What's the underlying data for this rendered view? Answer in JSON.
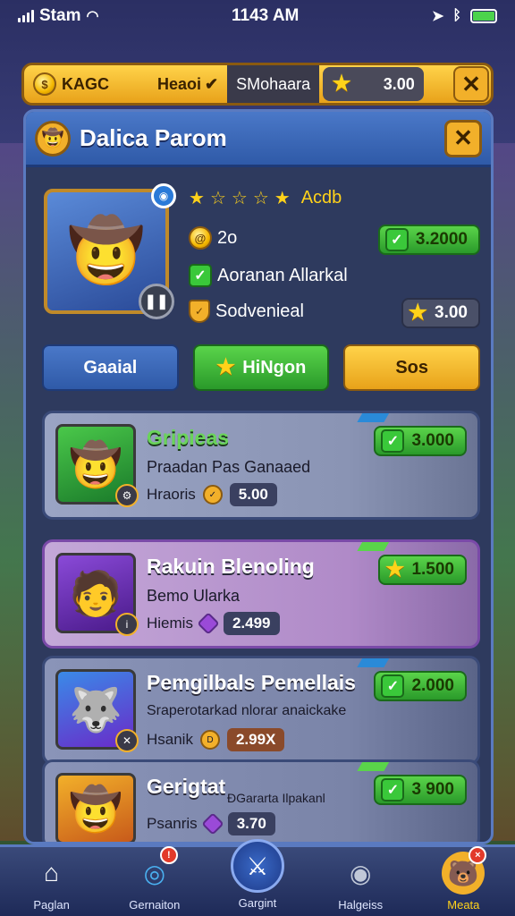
{
  "status": {
    "carrier": "Stam",
    "time": "1143 AM"
  },
  "topbar": {
    "seg1": "KAGC",
    "seg2": "Heaoi",
    "seg3": "SMohaara",
    "currency_value": "3.00"
  },
  "panel": {
    "title": "Dalica Parom"
  },
  "profile": {
    "rating_label": "Acdb",
    "level": "2o",
    "line1": "Aoranan Allarkal",
    "line2": "Sodvenieal",
    "pill1_value": "3.2000",
    "pill2_value": "3.00"
  },
  "tabs": [
    {
      "label": "Gaaial"
    },
    {
      "label": "HiNgon"
    },
    {
      "label": "Sos"
    }
  ],
  "cards": [
    {
      "title": "Gripieas",
      "subtitle": "Praadan  Pas Ganaaed",
      "meta_label": "Hraoris",
      "meta_value": "5.00",
      "price": "3.000"
    },
    {
      "title": "Rakuin Blenoling",
      "subtitle": "Bemo Ularka",
      "meta_label": "Hiemis",
      "meta_value": "2.499",
      "price": "1.500"
    },
    {
      "title": "Pemgilbals Pemellais",
      "subtitle": "Sraperotarkad nlorar anaickake",
      "meta_label": "Hsanik",
      "meta_value": "2.99X",
      "price": "2.000"
    },
    {
      "title": "Gerigtat",
      "subtitle": "ĐGararta Ilpakanl",
      "meta_label": "Psanris",
      "meta_value": "3.70",
      "price": "3 900"
    }
  ],
  "nav": [
    {
      "label": "Paglan",
      "icon": "home-icon"
    },
    {
      "label": "Gernaiton",
      "icon": "target-icon",
      "badge": "!"
    },
    {
      "label": "Gargint",
      "icon": "swords-icon"
    },
    {
      "label": "Halgeiss",
      "icon": "robot-icon"
    },
    {
      "label": "Meata",
      "icon": "pet-icon",
      "badge": "×"
    }
  ],
  "colors": {
    "accent_gold": "#f2b02a",
    "accent_green": "#3ac83a",
    "panel_blue": "#2f5aa8"
  }
}
